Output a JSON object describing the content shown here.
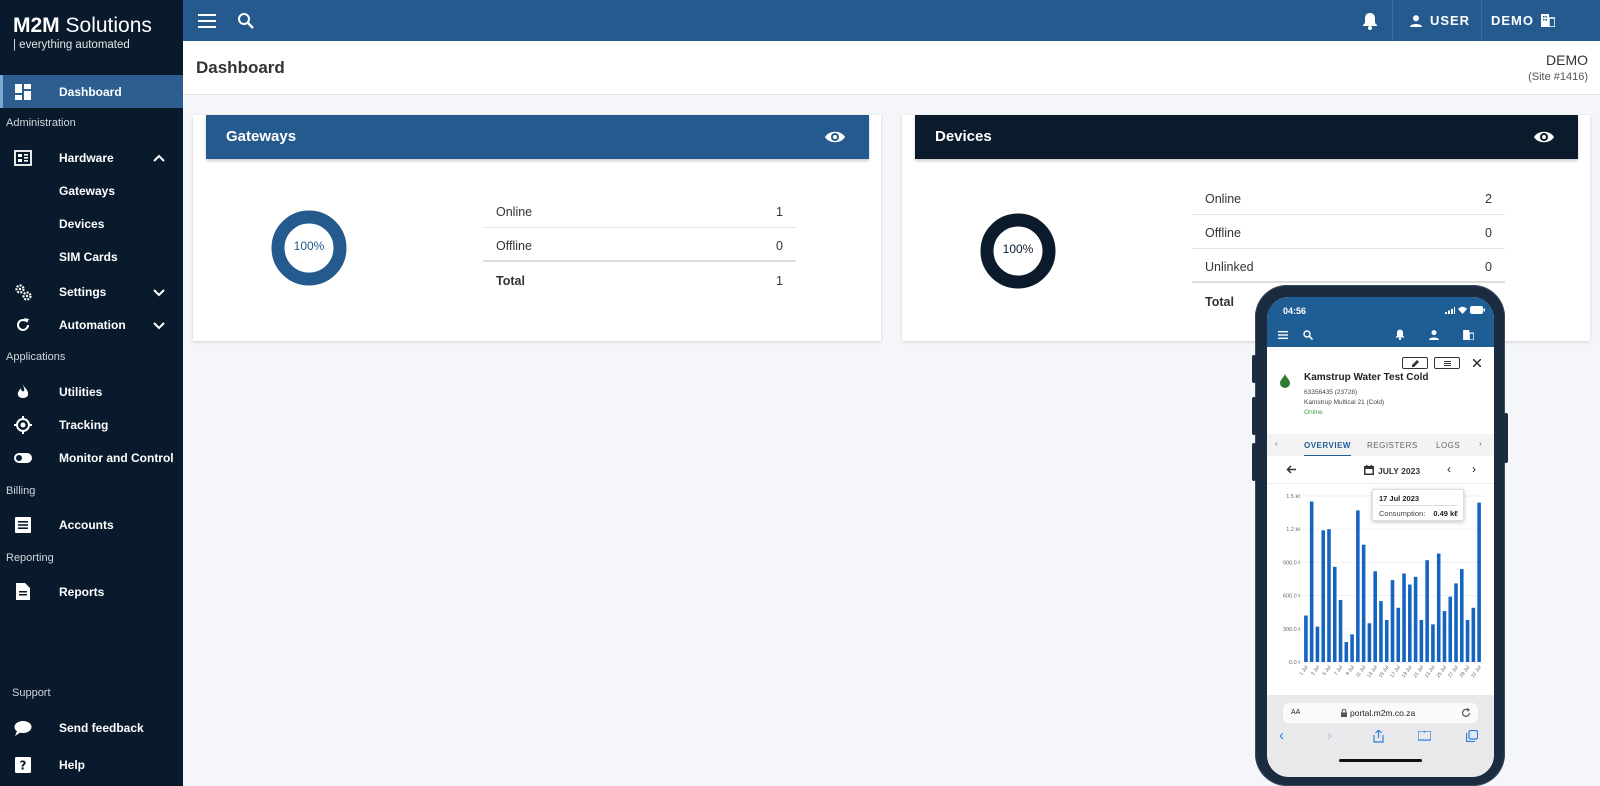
{
  "brand": {
    "name_bold": "M2M",
    "name_rest": "Solutions",
    "tagline": "| everything automated"
  },
  "sidebar": {
    "dashboard": "Dashboard",
    "sections": {
      "administration": "Administration",
      "applications": "Applications",
      "billing": "Billing",
      "reporting": "Reporting",
      "support": "Support"
    },
    "hardware": {
      "label": "Hardware",
      "children": [
        "Gateways",
        "Devices",
        "SIM Cards"
      ]
    },
    "settings": "Settings",
    "automation": "Automation",
    "utilities": "Utilities",
    "tracking": "Tracking",
    "monitor": "Monitor and Control",
    "accounts": "Accounts",
    "reports": "Reports",
    "feedback": "Send feedback",
    "help": "Help"
  },
  "topbar": {
    "user_label": "USER",
    "site_label": "DEMO"
  },
  "page": {
    "title": "Dashboard",
    "site_name": "DEMO",
    "site_id": "(Site #1416)"
  },
  "gateways": {
    "title": "Gateways",
    "percent_label": "100%",
    "rows": [
      {
        "label": "Online",
        "value": "1"
      },
      {
        "label": "Offline",
        "value": "0"
      }
    ],
    "total": {
      "label": "Total",
      "value": "1"
    },
    "color": "#245a8d"
  },
  "devices": {
    "title": "Devices",
    "percent_label": "100%",
    "rows": [
      {
        "label": "Online",
        "value": "2"
      },
      {
        "label": "Offline",
        "value": "0"
      },
      {
        "label": "Unlinked",
        "value": "0"
      }
    ],
    "total": {
      "label": "Total"
    },
    "color": "#0b1b2b"
  },
  "phone": {
    "time": "04:56",
    "device_name": "Kamstrup Water Test Cold",
    "device_serial": "63356435 (23728)",
    "device_model": "Kamstrup Multical 21 (Cold)",
    "device_status": "Online",
    "tabs": [
      "OVERVIEW",
      "REGISTERS",
      "LOGS"
    ],
    "month": "JULY 2023",
    "url": "portal.m2m.co.za",
    "url_prefix": "AA",
    "tooltip": {
      "date": "17 Jul 2023",
      "label": "Consumption:",
      "value": "0.49 kℓ"
    }
  },
  "chart_data": {
    "type": "bar",
    "ylabel": "",
    "ylim": [
      0,
      1500
    ],
    "yticks": [
      "0.0 ℓ",
      "300.0 ℓ",
      "600.0 ℓ",
      "900.0 ℓ",
      "1.2 kℓ",
      "1.5 kℓ"
    ],
    "categories": [
      "1 Jul",
      "2 Jul",
      "3 Jul",
      "4 Jul",
      "5 Jul",
      "6 Jul",
      "7 Jul",
      "8 Jul",
      "9 Jul",
      "10 Jul",
      "11 Jul",
      "12 Jul",
      "13 Jul",
      "14 Jul",
      "15 Jul",
      "16 Jul",
      "17 Jul",
      "18 Jul",
      "19 Jul",
      "20 Jul",
      "21 Jul",
      "22 Jul",
      "23 Jul",
      "24 Jul",
      "25 Jul",
      "26 Jul",
      "27 Jul",
      "28 Jul",
      "29 Jul",
      "30 Jul",
      "31 Jul"
    ],
    "xtick_labels": [
      "1 Jul",
      "3 Jul",
      "5 Jul",
      "7 Jul",
      "9 Jul",
      "11 Jul",
      "13 Jul",
      "15 Jul",
      "17 Jul",
      "19 Jul",
      "21 Jul",
      "23 Jul",
      "25 Jul",
      "27 Jul",
      "29 Jul",
      "31 Jul"
    ],
    "values": [
      420,
      1450,
      320,
      1190,
      1200,
      860,
      560,
      180,
      250,
      1370,
      1060,
      350,
      820,
      550,
      380,
      740,
      490,
      800,
      700,
      770,
      380,
      920,
      340,
      980,
      460,
      590,
      710,
      840,
      380,
      490,
      1440
    ],
    "color": "#1565c0"
  }
}
